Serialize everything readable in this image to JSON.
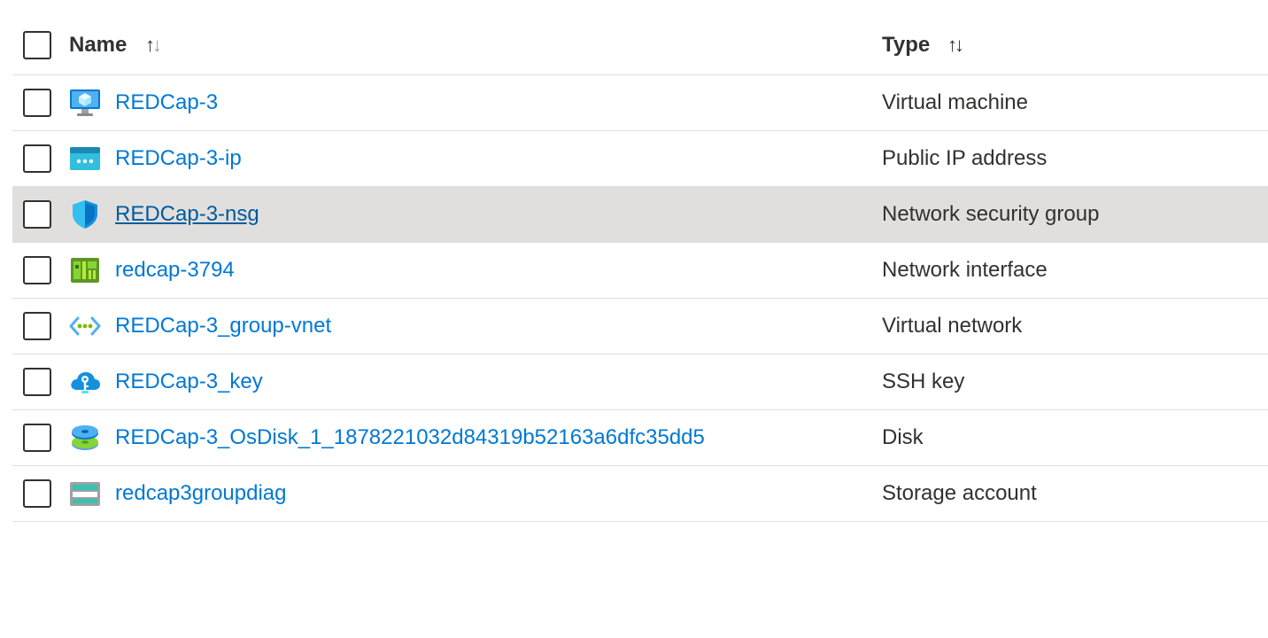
{
  "header": {
    "name_label": "Name",
    "type_label": "Type",
    "sort_up": "↑",
    "sort_down": "↓"
  },
  "resources": [
    {
      "name": "REDCap-3",
      "type": "Virtual machine",
      "icon": "virtual-machine-icon"
    },
    {
      "name": "REDCap-3-ip",
      "type": "Public IP address",
      "icon": "public-ip-icon"
    },
    {
      "name": "REDCap-3-nsg",
      "type": "Network security group",
      "icon": "shield-icon"
    },
    {
      "name": "redcap-3794",
      "type": "Network interface",
      "icon": "network-interface-icon"
    },
    {
      "name": "REDCap-3_group-vnet",
      "type": "Virtual network",
      "icon": "virtual-network-icon"
    },
    {
      "name": "REDCap-3_key",
      "type": "SSH key",
      "icon": "ssh-key-icon"
    },
    {
      "name": "REDCap-3_OsDisk_1_1878221032d84319b52163a6dfc35dd5",
      "type": "Disk",
      "icon": "disk-icon"
    },
    {
      "name": "redcap3groupdiag",
      "type": "Storage account",
      "icon": "storage-account-icon"
    }
  ],
  "colors": {
    "link": "#0078d4",
    "hover_row": "#e1dfdd",
    "text": "#323130"
  }
}
